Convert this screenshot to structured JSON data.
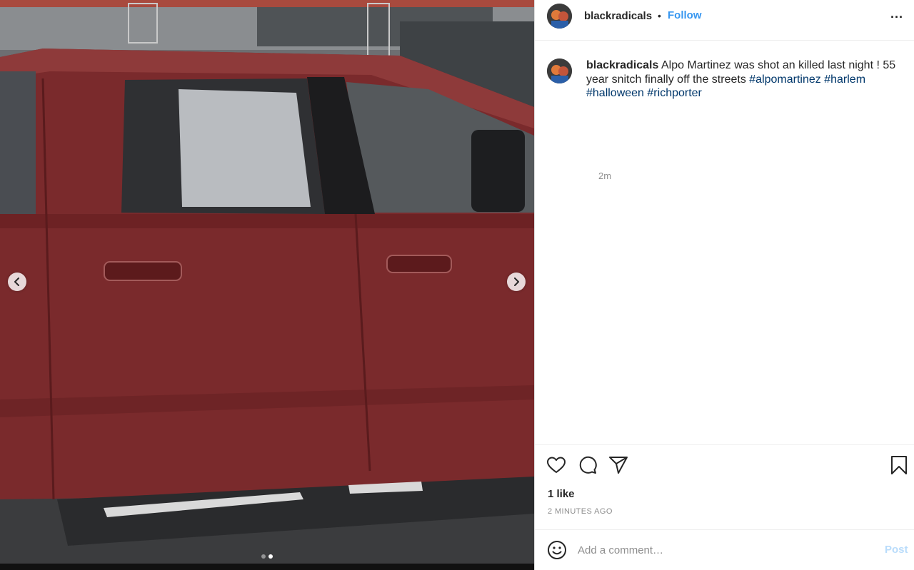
{
  "post": {
    "username": "blackradicals",
    "separator": "•",
    "follow_label": "Follow",
    "more_icon": "more-options-icon",
    "caption": {
      "username": "blackradicals",
      "text": "Alpo Martinez was shot an killed last night ! 55 year snitch finally off the streets",
      "hashtags": [
        "#alpomartinez",
        "#harlem",
        "#halloween",
        "#richporter"
      ]
    },
    "relative_time": "2m",
    "likes": "1 like",
    "timestamp": "2 MINUTES AGO"
  },
  "media": {
    "prev_icon": "chevron-left-icon",
    "next_icon": "chevron-right-icon",
    "slide_count": 2,
    "active_slide": 2
  },
  "actions": {
    "like_icon": "heart-icon",
    "comment_icon": "comment-icon",
    "share_icon": "share-icon",
    "save_icon": "bookmark-icon"
  },
  "comment": {
    "placeholder": "Add a comment…",
    "post_label": "Post",
    "post_color": "#b9dcfb"
  },
  "colors": {
    "follow": "#3897f0",
    "hashtag": "#00376b",
    "muted": "#8e8e8e"
  }
}
